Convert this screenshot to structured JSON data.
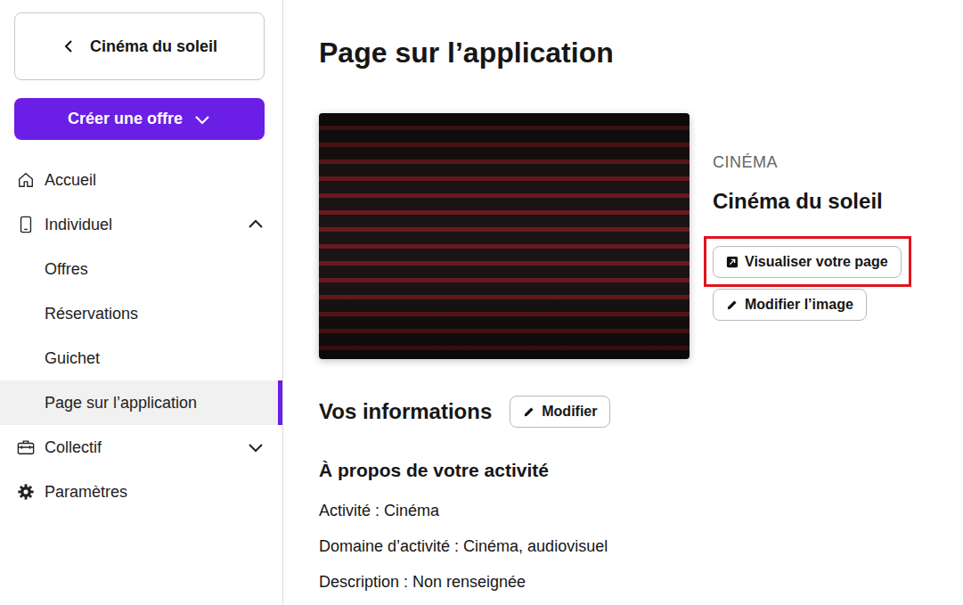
{
  "sidebar": {
    "back_button": {
      "label": "Cinéma du soleil"
    },
    "create_button": {
      "label": "Créer une offre"
    },
    "items": [
      {
        "label": "Accueil",
        "kind": "link",
        "selected": false
      },
      {
        "label": "Individuel",
        "kind": "group",
        "expanded": true,
        "selected": false
      },
      {
        "label": "Offres",
        "kind": "subitem",
        "selected": false
      },
      {
        "label": "Réservations",
        "kind": "subitem",
        "selected": false
      },
      {
        "label": "Guichet",
        "kind": "subitem",
        "selected": false
      },
      {
        "label": "Page sur l’application",
        "kind": "subitem",
        "selected": true
      },
      {
        "label": "Collectif",
        "kind": "group",
        "expanded": false,
        "selected": false
      },
      {
        "label": "Paramètres",
        "kind": "link",
        "selected": false
      }
    ]
  },
  "page": {
    "title": "Page sur l’application",
    "venue": {
      "category": "CINÉMA",
      "name": "Cinéma du soleil"
    },
    "venue_buttons": [
      {
        "label": "Visualiser votre page",
        "kind": "external",
        "highlighted": true
      },
      {
        "label": "Modifier l’image",
        "kind": "edit",
        "highlighted": false
      }
    ],
    "info": {
      "title": "Vos informations",
      "edit_button": "Modifier",
      "section_title": "À propos de votre activité",
      "lines": [
        "Activité : Cinéma",
        "Domaine d’activité : Cinéma, audiovisuel",
        "Description : Non renseignée"
      ]
    }
  }
}
